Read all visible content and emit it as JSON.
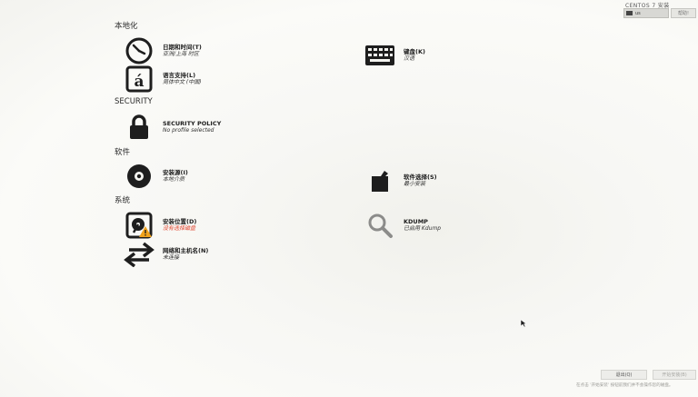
{
  "header": {
    "product_title": "CENTOS 7 安装",
    "keyboard_layout": "us",
    "help_label": "帮助!"
  },
  "categories": {
    "localization": "本地化",
    "security": "SECURITY",
    "software": "软件",
    "system": "系统"
  },
  "spokes": {
    "datetime": {
      "title": "日期和时间(T)",
      "status": "亚洲/上海 时区",
      "icon": "clock-icon"
    },
    "keyboard": {
      "title": "键盘(K)",
      "status": "汉语",
      "icon": "keyboard-icon"
    },
    "language": {
      "title": "语言支持(L)",
      "status": "简体中文 (中国)",
      "icon": "language-icon"
    },
    "security_policy": {
      "title": "SECURITY POLICY",
      "status": "No profile selected",
      "icon": "lock-icon"
    },
    "install_source": {
      "title": "安装源(I)",
      "status": "本地介质",
      "icon": "disc-icon"
    },
    "software_selection": {
      "title": "软件选择(S)",
      "status": "最小安装",
      "icon": "package-icon"
    },
    "install_destination": {
      "title": "安装位置(D)",
      "status": "没有选择磁盘",
      "icon": "harddisk-warning-icon"
    },
    "kdump": {
      "title": "KDUMP",
      "status": "已启用 Kdump",
      "icon": "magnifier-icon"
    },
    "network": {
      "title": "网络和主机名(N)",
      "status": "未连接",
      "icon": "network-arrows-icon"
    }
  },
  "footer": {
    "quit_label": "退出(Q)",
    "begin_label": "开始安装(B)",
    "note": "在点击 '开始安装' 按钮前我们并不会操作您的磁盘。"
  },
  "colors": {
    "warning": "#e0412a",
    "warning_badge": "#f0a21c",
    "icon": "#1e1e1e"
  }
}
